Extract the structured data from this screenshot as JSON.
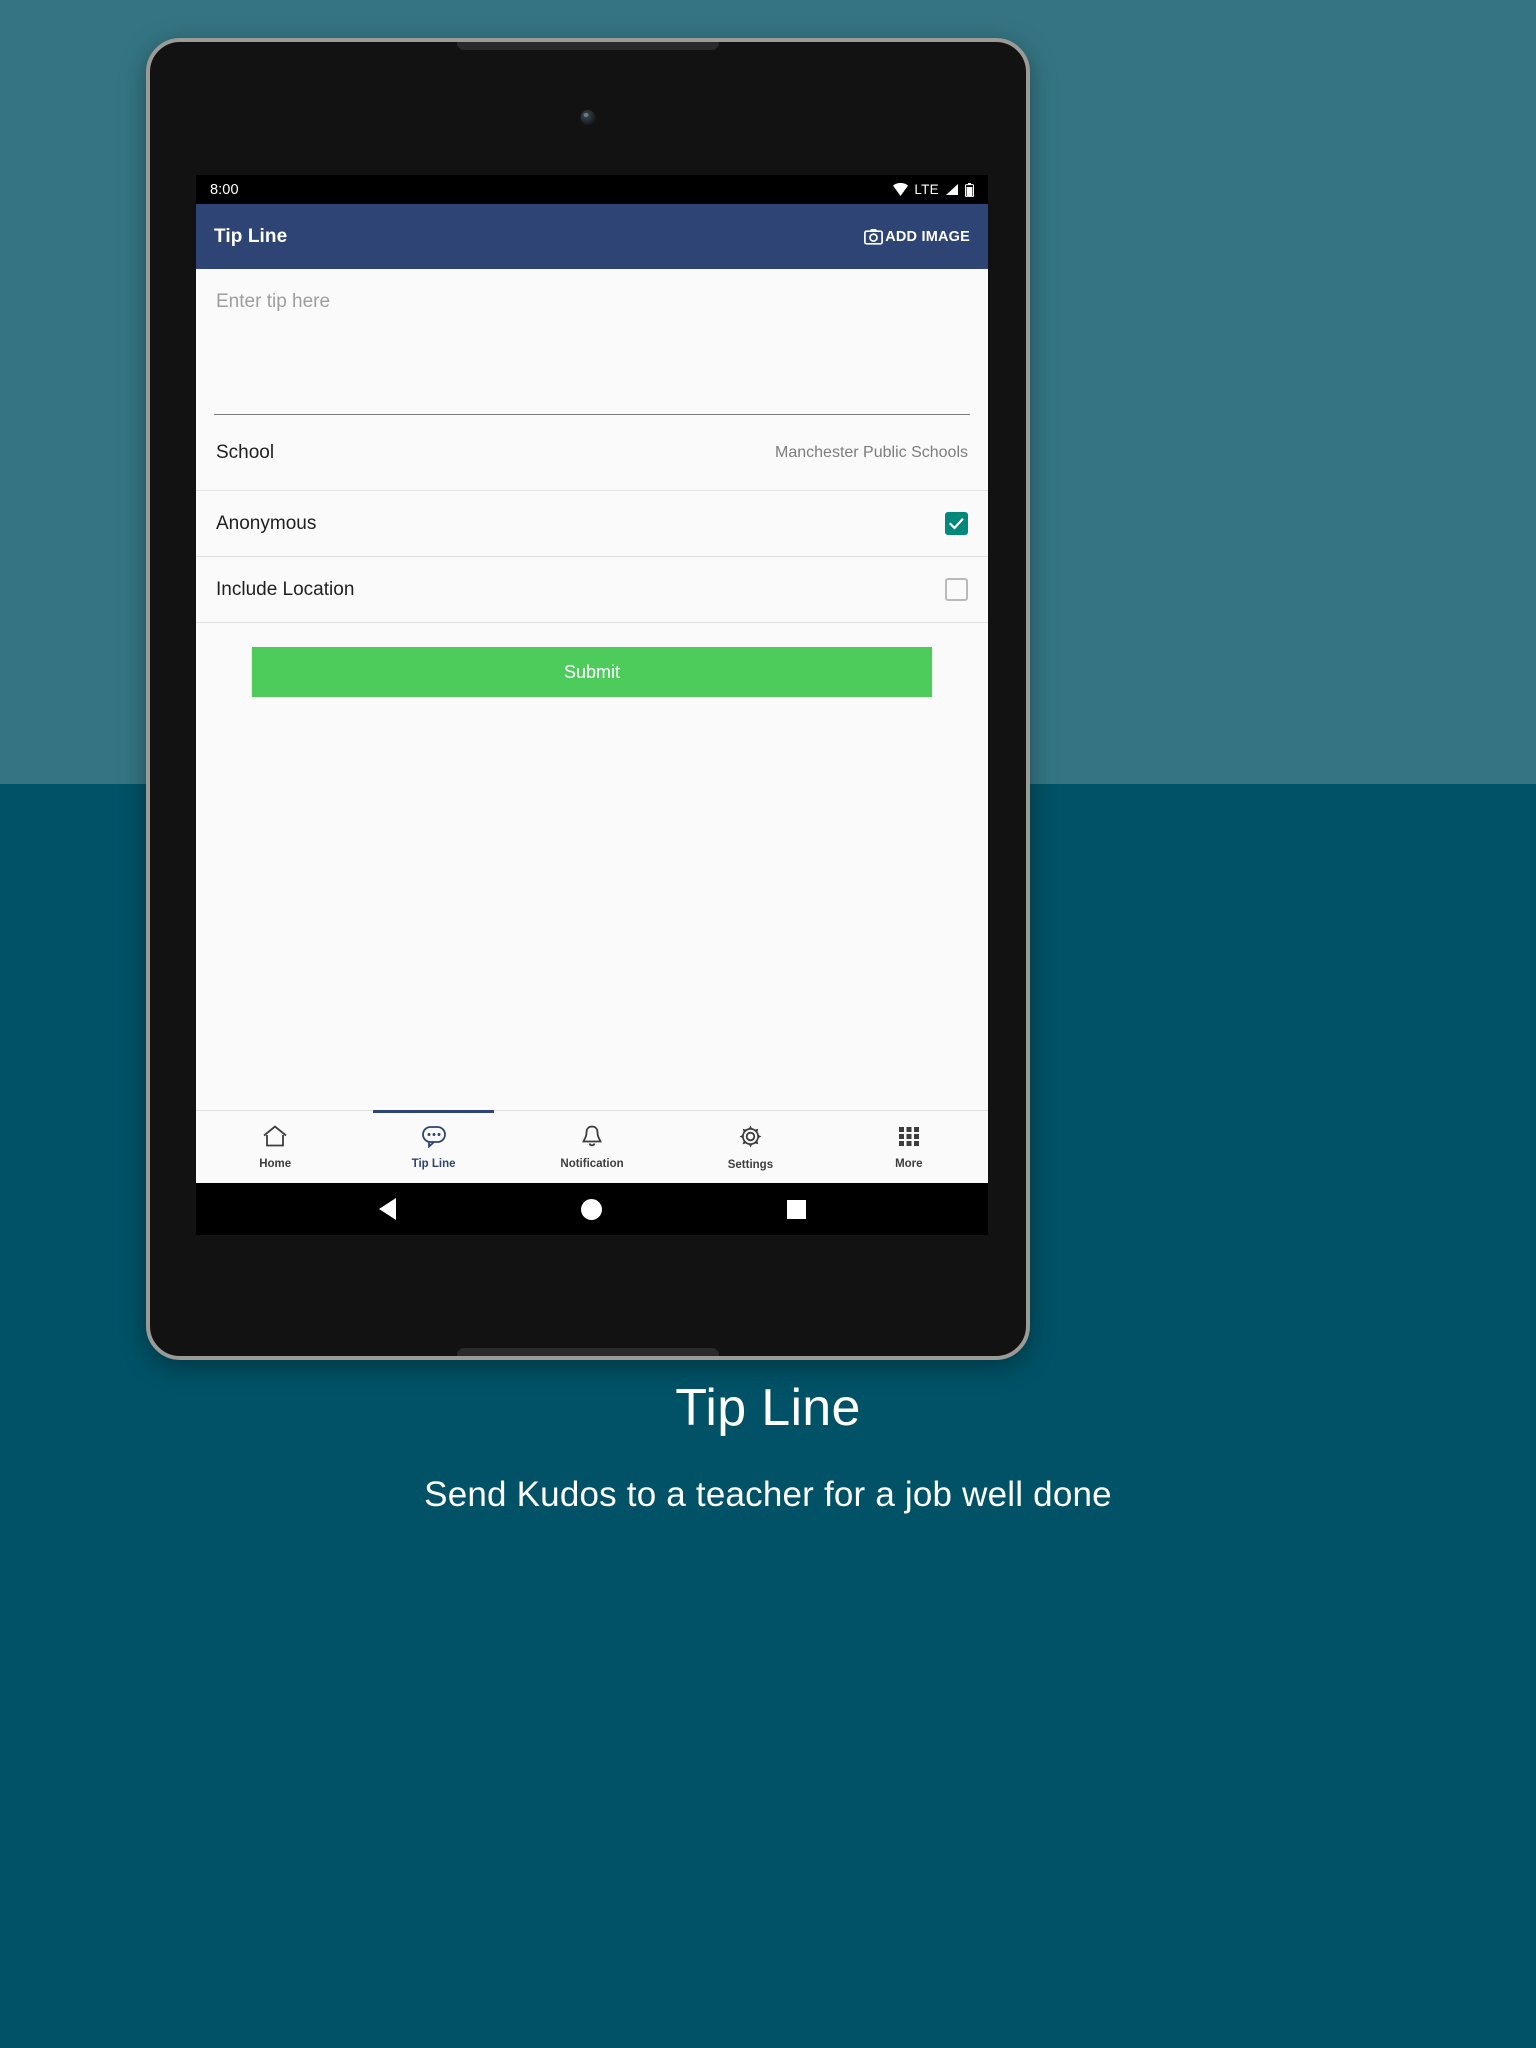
{
  "statusbar": {
    "time": "8:00",
    "network_label": "LTE",
    "icons": [
      "wifi-icon",
      "signal-icon",
      "battery-icon"
    ]
  },
  "appbar": {
    "title": "Tip Line",
    "action_label": "ADD IMAGE",
    "action_icon": "camera-icon",
    "background_color": "#2d4474"
  },
  "form": {
    "tip_input": {
      "value": "",
      "placeholder": "Enter tip here"
    },
    "school_row": {
      "label": "School",
      "value": "Manchester Public Schools"
    },
    "anonymous_row": {
      "label": "Anonymous",
      "checked": true,
      "check_color": "#00897b"
    },
    "location_row": {
      "label": "Include Location",
      "checked": false
    },
    "submit": {
      "label": "Submit",
      "color": "#4dcb5b"
    }
  },
  "bottom_nav": {
    "active_index": 1,
    "accent_color": "#2d4474",
    "tabs": [
      {
        "label": "Home",
        "icon": "home-icon"
      },
      {
        "label": "Tip Line",
        "icon": "chat-bubble-icon"
      },
      {
        "label": "Notification",
        "icon": "bell-icon"
      },
      {
        "label": "Settings",
        "icon": "gear-icon"
      },
      {
        "label": "More",
        "icon": "grid-dots-icon"
      }
    ]
  },
  "android_nav": {
    "back": "back-triangle-icon",
    "home": "home-circle-icon",
    "recents": "recents-square-icon"
  },
  "caption": {
    "title": "Tip Line",
    "subtitle": "Send Kudos to a teacher for a job well done"
  }
}
